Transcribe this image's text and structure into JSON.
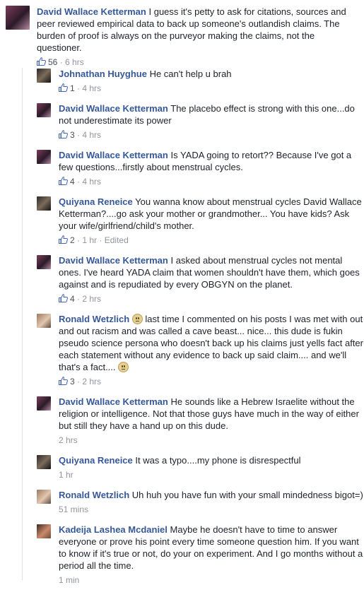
{
  "top_comment": {
    "author": "David Wallace Ketterman",
    "text": "I guess it's petty to ask for citations, sources and peer reviewed empirical data to back up someone's outlandish claims. The burden of proof is always on the purveyor making the claims, not the questioner.",
    "likes": "56",
    "time": "6 hrs"
  },
  "separator": " · ",
  "replies": [
    {
      "author": "Johnathan Huyghue",
      "text": "He can't help u brah",
      "likes": "1",
      "time": "4 hrs"
    },
    {
      "author": "David Wallace Ketterman",
      "text": "The placebo effect is strong with this one...do not underestimate its power",
      "likes": "3",
      "time": "4 hrs"
    },
    {
      "author": "David Wallace Ketterman",
      "text": "Is YADA going to retort?? Because I've got a few questions...firstly about menstrual cycles.",
      "likes": "4",
      "time": "4 hrs"
    },
    {
      "author": "Quiyana Reneice",
      "text": "You wanna know about menstrual cycles David Wallace Ketterman?....go ask your mother or grandmother... You have kids? Ask your wife/girlfriend/child's mother.",
      "likes": "2",
      "time": "1 hr",
      "edited": "Edited"
    },
    {
      "author": "David Wallace Ketterman",
      "text": "I asked about menstrual cycles not mental ones. I've heard YADA claim that women shouldn't have them, which goes against and is repudiated by every OBGYN on the planet.",
      "likes": "4",
      "time": "2 hrs"
    },
    {
      "author": "Ronald Wetzlich",
      "text_a": "last time I commented on his posts I was met with out and out racism and was called a cave beast... nice... this dude is fukin pseudo science persona who doesn't back up his claims just yells fact after each statement without any evidence to back up said claim.... and we'll that's a fact....",
      "likes": "3",
      "time": "2 hrs"
    },
    {
      "author": "David Wallace Ketterman",
      "text": "He sounds like a Hebrew Israelite without the religion or intelligence. Not that those guys have much in the way of either but still they have a hand up on this dude.",
      "time": "2 hrs"
    },
    {
      "author": "Quiyana Reneice",
      "text": "It was a typo....my phone is disrespectful",
      "time": "1 hr"
    },
    {
      "author": "Ronald Wetzlich",
      "text": "Uh huh you have fun with your small mindedness bigot=)",
      "time": "51 mins"
    },
    {
      "author": "Kadeija Lashea Mcdaniel",
      "text": "Maybe he doesn't have to time to answer everyone or prove his point every time someone question him. If you want to know if it's true or not, do your on experiment. And I go months without a period all the time.",
      "time": "1 min"
    }
  ]
}
